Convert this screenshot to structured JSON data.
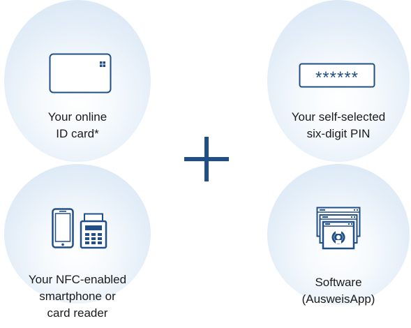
{
  "accent_color": "#1f4f86",
  "items": [
    {
      "icon": "id-card-icon",
      "label_lines": [
        "Your online",
        "ID card*"
      ]
    },
    {
      "icon": "pin-field-icon",
      "pin_mask": "******",
      "label_lines": [
        "Your self-selected",
        "six-digit PIN"
      ]
    },
    {
      "icon": "smartphone-card-reader-icon",
      "label_lines": [
        "Your NFC-enabled",
        "smartphone or",
        "card reader"
      ]
    },
    {
      "icon": "software-window-icon",
      "label_lines": [
        "Software",
        "(AusweisApp)"
      ]
    }
  ],
  "connector_icon": "plus-icon"
}
